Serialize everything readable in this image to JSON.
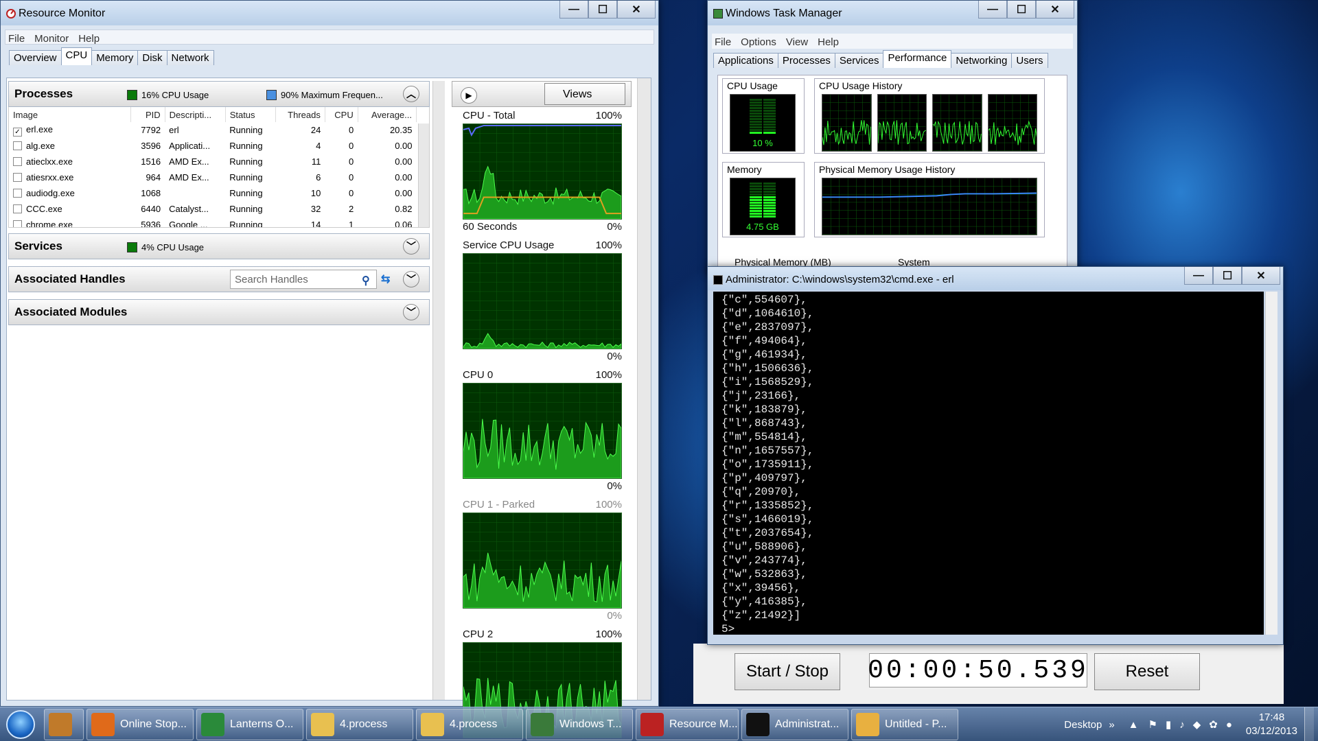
{
  "resmon": {
    "title": "Resource Monitor",
    "menu": [
      "File",
      "Monitor",
      "Help"
    ],
    "tabs": [
      "Overview",
      "CPU",
      "Memory",
      "Disk",
      "Network"
    ],
    "processes": {
      "title": "Processes",
      "cpu_usage": "16% CPU Usage",
      "max_freq": "90% Maximum Frequen...",
      "columns": [
        "Image",
        "PID",
        "Descripti...",
        "Status",
        "Threads",
        "CPU",
        "Average..."
      ],
      "rows": [
        {
          "checked": true,
          "image": "erl.exe",
          "pid": "7792",
          "desc": "erl",
          "status": "Running",
          "threads": "24",
          "cpu": "0",
          "avg": "20.35"
        },
        {
          "checked": false,
          "image": "alg.exe",
          "pid": "3596",
          "desc": "Applicati...",
          "status": "Running",
          "threads": "4",
          "cpu": "0",
          "avg": "0.00"
        },
        {
          "checked": false,
          "image": "atieclxx.exe",
          "pid": "1516",
          "desc": "AMD Ex...",
          "status": "Running",
          "threads": "11",
          "cpu": "0",
          "avg": "0.00"
        },
        {
          "checked": false,
          "image": "atiesrxx.exe",
          "pid": "964",
          "desc": "AMD Ex...",
          "status": "Running",
          "threads": "6",
          "cpu": "0",
          "avg": "0.00"
        },
        {
          "checked": false,
          "image": "audiodg.exe",
          "pid": "1068",
          "desc": "",
          "status": "Running",
          "threads": "10",
          "cpu": "0",
          "avg": "0.00"
        },
        {
          "checked": false,
          "image": "CCC.exe",
          "pid": "6440",
          "desc": "Catalyst...",
          "status": "Running",
          "threads": "32",
          "cpu": "2",
          "avg": "0.82"
        },
        {
          "checked": false,
          "image": "chrome.exe",
          "pid": "5936",
          "desc": "Google ...",
          "status": "Running",
          "threads": "14",
          "cpu": "1",
          "avg": "0.06"
        }
      ]
    },
    "services": {
      "title": "Services",
      "cpu_usage": "4% CPU Usage"
    },
    "handles": {
      "title": "Associated Handles",
      "search_placeholder": "Search Handles"
    },
    "modules": {
      "title": "Associated Modules"
    },
    "views_label": "Views",
    "graphs": [
      {
        "label": "CPU - Total",
        "max": "100%",
        "bottom_left": "60 Seconds",
        "min": "0%"
      },
      {
        "label": "Service CPU Usage",
        "max": "100%",
        "bottom_left": "",
        "min": "0%"
      },
      {
        "label": "CPU 0",
        "max": "100%",
        "bottom_left": "",
        "min": "0%"
      },
      {
        "label": "CPU 1 - Parked",
        "max": "100%",
        "bottom_left": "",
        "min": "0%"
      },
      {
        "label": "CPU 2",
        "max": "100%",
        "bottom_left": "",
        "min": ""
      }
    ]
  },
  "taskmgr": {
    "title": "Windows Task Manager",
    "menu": [
      "File",
      "Options",
      "View",
      "Help"
    ],
    "tabs": [
      "Applications",
      "Processes",
      "Services",
      "Performance",
      "Networking",
      "Users"
    ],
    "cpu_usage_label": "CPU Usage",
    "cpu_usage_value": "10 %",
    "cpu_history_label": "CPU Usage History",
    "memory_label": "Memory",
    "memory_value": "4.75 GB",
    "mem_history_label": "Physical Memory Usage History",
    "phys_mem_label": "Physical Memory (MB)",
    "system_label": "System"
  },
  "cmd": {
    "title": "Administrator: C:\\windows\\system32\\cmd.exe - erl",
    "lines": [
      "{\"c\",554607},",
      "{\"d\",1064610},",
      "{\"e\",2837097},",
      "{\"f\",494064},",
      "{\"g\",461934},",
      "{\"h\",1506636},",
      "{\"i\",1568529},",
      "{\"j\",23166},",
      "{\"k\",183879},",
      "{\"l\",868743},",
      "{\"m\",554814},",
      "{\"n\",1657557},",
      "{\"o\",1735911},",
      "{\"p\",409797},",
      "{\"q\",20970},",
      "{\"r\",1335852},",
      "{\"s\",1466019},",
      "{\"t\",2037654},",
      "{\"u\",588906},",
      "{\"v\",243774},",
      "{\"w\",532863},",
      "{\"x\",39456},",
      "{\"y\",416385},",
      "{\"z\",21492}]"
    ],
    "prompt": "5>"
  },
  "stopwatch": {
    "start_stop": "Start / Stop",
    "time": "00:00:50.539",
    "reset": "Reset"
  },
  "taskbar": {
    "items": [
      "",
      "Online Stop...",
      "Lanterns O...",
      "4.process",
      "4.process",
      "Windows T...",
      "Resource M...",
      "Administrat...",
      "Untitled - P..."
    ],
    "desktop": "Desktop",
    "time": "17:48",
    "date": "03/12/2013"
  }
}
